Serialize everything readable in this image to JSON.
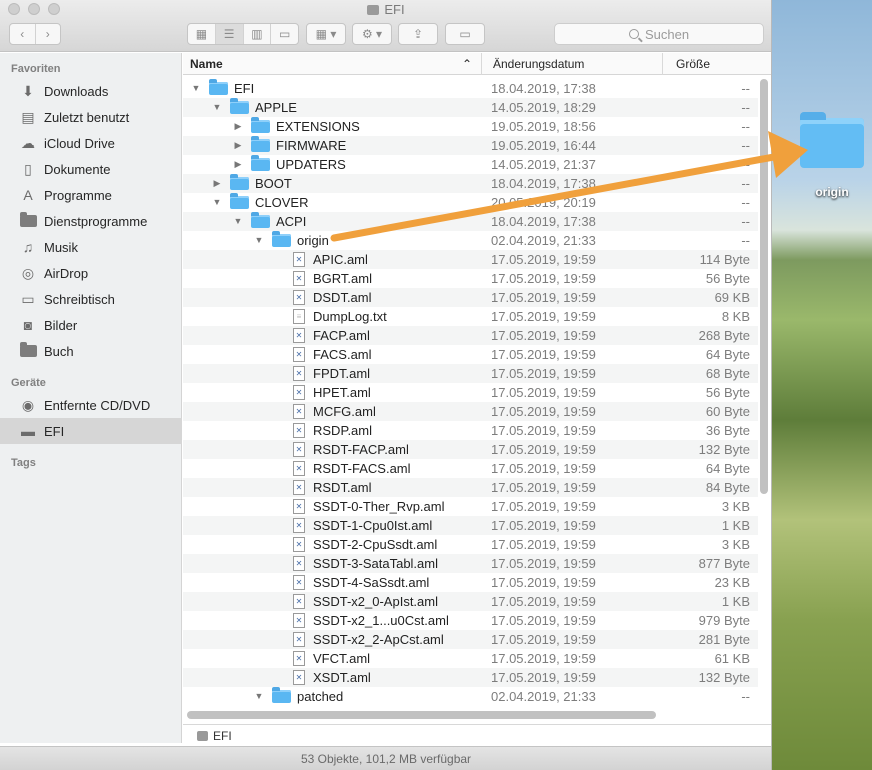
{
  "window": {
    "title": "EFI"
  },
  "toolbar": {
    "search_placeholder": "Suchen"
  },
  "sidebar": {
    "favorites_label": "Favoriten",
    "favorites": [
      {
        "label": "Downloads",
        "icon": "download-icon"
      },
      {
        "label": "Zuletzt benutzt",
        "icon": "recents-icon"
      },
      {
        "label": "iCloud Drive",
        "icon": "cloud-icon"
      },
      {
        "label": "Dokumente",
        "icon": "document-icon"
      },
      {
        "label": "Programme",
        "icon": "applications-icon"
      },
      {
        "label": "Dienstprogramme",
        "icon": "folder-icon"
      },
      {
        "label": "Musik",
        "icon": "music-icon"
      },
      {
        "label": "AirDrop",
        "icon": "airdrop-icon"
      },
      {
        "label": "Schreibtisch",
        "icon": "desktop-icon"
      },
      {
        "label": "Bilder",
        "icon": "camera-icon"
      },
      {
        "label": "Buch",
        "icon": "folder-icon"
      }
    ],
    "devices_label": "Geräte",
    "devices": [
      {
        "label": "Entfernte CD/DVD",
        "icon": "disc-icon"
      },
      {
        "label": "EFI",
        "icon": "disk-icon"
      }
    ],
    "tags_label": "Tags"
  },
  "columns": {
    "name": "Name",
    "date": "Änderungsdatum",
    "size": "Größe"
  },
  "files": [
    {
      "name": "EFI",
      "date": "18.04.2019, 17:38",
      "size": "--",
      "level": 0,
      "kind": "folder",
      "expanded": true
    },
    {
      "name": "APPLE",
      "date": "14.05.2019, 18:29",
      "size": "--",
      "level": 1,
      "kind": "folder",
      "expanded": true
    },
    {
      "name": "EXTENSIONS",
      "date": "19.05.2019, 18:56",
      "size": "--",
      "level": 2,
      "kind": "folder",
      "expanded": false
    },
    {
      "name": "FIRMWARE",
      "date": "19.05.2019, 16:44",
      "size": "--",
      "level": 2,
      "kind": "folder",
      "expanded": false
    },
    {
      "name": "UPDATERS",
      "date": "14.05.2019, 21:37",
      "size": "--",
      "level": 2,
      "kind": "folder",
      "expanded": false
    },
    {
      "name": "BOOT",
      "date": "18.04.2019, 17:38",
      "size": "--",
      "level": 1,
      "kind": "folder",
      "expanded": false
    },
    {
      "name": "CLOVER",
      "date": "20.05.2019, 20:19",
      "size": "--",
      "level": 1,
      "kind": "folder",
      "expanded": true
    },
    {
      "name": "ACPI",
      "date": "18.04.2019, 17:38",
      "size": "--",
      "level": 2,
      "kind": "folder",
      "expanded": true
    },
    {
      "name": "origin",
      "date": "02.04.2019, 21:33",
      "size": "--",
      "level": 3,
      "kind": "folder",
      "expanded": true
    },
    {
      "name": "APIC.aml",
      "date": "17.05.2019, 19:59",
      "size": "114 Byte",
      "level": 4,
      "kind": "aml"
    },
    {
      "name": "BGRT.aml",
      "date": "17.05.2019, 19:59",
      "size": "56 Byte",
      "level": 4,
      "kind": "aml"
    },
    {
      "name": "DSDT.aml",
      "date": "17.05.2019, 19:59",
      "size": "69 KB",
      "level": 4,
      "kind": "aml"
    },
    {
      "name": "DumpLog.txt",
      "date": "17.05.2019, 19:59",
      "size": "8 KB",
      "level": 4,
      "kind": "txt"
    },
    {
      "name": "FACP.aml",
      "date": "17.05.2019, 19:59",
      "size": "268 Byte",
      "level": 4,
      "kind": "aml"
    },
    {
      "name": "FACS.aml",
      "date": "17.05.2019, 19:59",
      "size": "64 Byte",
      "level": 4,
      "kind": "aml"
    },
    {
      "name": "FPDT.aml",
      "date": "17.05.2019, 19:59",
      "size": "68 Byte",
      "level": 4,
      "kind": "aml"
    },
    {
      "name": "HPET.aml",
      "date": "17.05.2019, 19:59",
      "size": "56 Byte",
      "level": 4,
      "kind": "aml"
    },
    {
      "name": "MCFG.aml",
      "date": "17.05.2019, 19:59",
      "size": "60 Byte",
      "level": 4,
      "kind": "aml"
    },
    {
      "name": "RSDP.aml",
      "date": "17.05.2019, 19:59",
      "size": "36 Byte",
      "level": 4,
      "kind": "aml"
    },
    {
      "name": "RSDT-FACP.aml",
      "date": "17.05.2019, 19:59",
      "size": "132 Byte",
      "level": 4,
      "kind": "aml"
    },
    {
      "name": "RSDT-FACS.aml",
      "date": "17.05.2019, 19:59",
      "size": "64 Byte",
      "level": 4,
      "kind": "aml"
    },
    {
      "name": "RSDT.aml",
      "date": "17.05.2019, 19:59",
      "size": "84 Byte",
      "level": 4,
      "kind": "aml"
    },
    {
      "name": "SSDT-0-Ther_Rvp.aml",
      "date": "17.05.2019, 19:59",
      "size": "3 KB",
      "level": 4,
      "kind": "aml"
    },
    {
      "name": "SSDT-1-Cpu0Ist.aml",
      "date": "17.05.2019, 19:59",
      "size": "1 KB",
      "level": 4,
      "kind": "aml"
    },
    {
      "name": "SSDT-2-CpuSsdt.aml",
      "date": "17.05.2019, 19:59",
      "size": "3 KB",
      "level": 4,
      "kind": "aml"
    },
    {
      "name": "SSDT-3-SataTabl.aml",
      "date": "17.05.2019, 19:59",
      "size": "877 Byte",
      "level": 4,
      "kind": "aml"
    },
    {
      "name": "SSDT-4-SaSsdt.aml",
      "date": "17.05.2019, 19:59",
      "size": "23 KB",
      "level": 4,
      "kind": "aml"
    },
    {
      "name": "SSDT-x2_0-ApIst.aml",
      "date": "17.05.2019, 19:59",
      "size": "1 KB",
      "level": 4,
      "kind": "aml"
    },
    {
      "name": "SSDT-x2_1...u0Cst.aml",
      "date": "17.05.2019, 19:59",
      "size": "979 Byte",
      "level": 4,
      "kind": "aml"
    },
    {
      "name": "SSDT-x2_2-ApCst.aml",
      "date": "17.05.2019, 19:59",
      "size": "281 Byte",
      "level": 4,
      "kind": "aml"
    },
    {
      "name": "VFCT.aml",
      "date": "17.05.2019, 19:59",
      "size": "61 KB",
      "level": 4,
      "kind": "aml"
    },
    {
      "name": "XSDT.aml",
      "date": "17.05.2019, 19:59",
      "size": "132 Byte",
      "level": 4,
      "kind": "aml"
    },
    {
      "name": "patched",
      "date": "02.04.2019, 21:33",
      "size": "--",
      "level": 3,
      "kind": "folder",
      "expanded": true
    }
  ],
  "pathbar": {
    "label": "EFI"
  },
  "status": {
    "text": "53 Objekte, 101,2 MB verfügbar"
  },
  "desktop": {
    "folder_label": "origin"
  },
  "colors": {
    "folder": "#5ab7f2",
    "arrow": "#f0a03c",
    "selection": "#d6d6d6"
  }
}
